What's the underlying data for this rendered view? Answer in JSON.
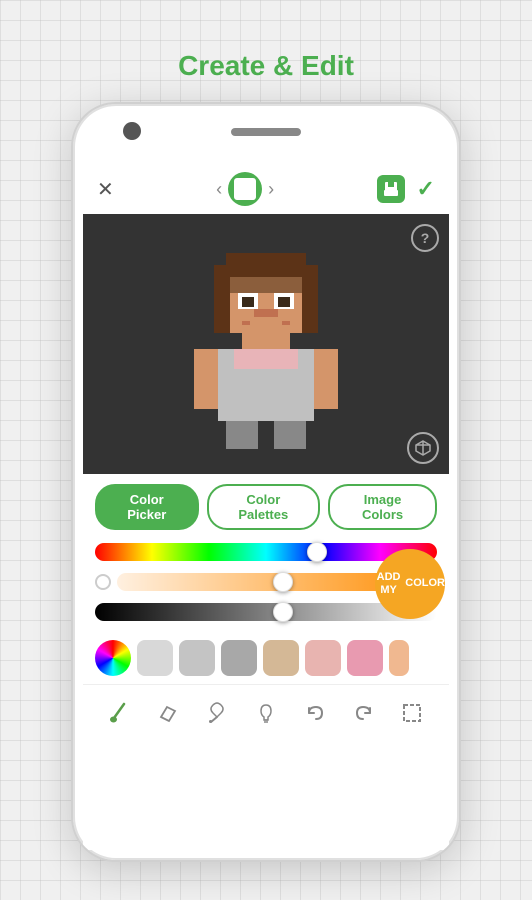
{
  "page": {
    "title": "Create & Edit",
    "background_color": "#f0f0f0"
  },
  "toolbar": {
    "close_label": "✕",
    "arrow_left_label": "‹",
    "arrow_right_label": "›",
    "check_label": "✓"
  },
  "canvas": {
    "help_label": "?",
    "cube_label": "⬡"
  },
  "tabs": [
    {
      "id": "color-picker",
      "label": "Color Picker",
      "active": true
    },
    {
      "id": "color-palettes",
      "label": "Color Palettes",
      "active": false
    },
    {
      "id": "image-colors",
      "label": "Image Colors",
      "active": false
    }
  ],
  "add_color_button": {
    "line1": "ADD MY",
    "line2": "COLOR"
  },
  "swatches": [
    {
      "color": "#d0d0d0"
    },
    {
      "color": "#c0c0c0"
    },
    {
      "color": "#a0a0a0"
    },
    {
      "color": "#d4b896"
    },
    {
      "color": "#e8b4b0"
    },
    {
      "color": "#e8a0b0"
    }
  ],
  "tools": [
    {
      "name": "paintbrush-icon",
      "symbol": "🖌"
    },
    {
      "name": "eraser-icon",
      "symbol": "⬡"
    },
    {
      "name": "eyedropper-icon",
      "symbol": "💉"
    },
    {
      "name": "lightbulb-icon",
      "symbol": "💡"
    },
    {
      "name": "undo-icon",
      "symbol": "↩"
    },
    {
      "name": "redo-icon",
      "symbol": "↪"
    },
    {
      "name": "select-icon",
      "symbol": "⬜"
    }
  ],
  "sliders": {
    "hue_position_pct": 65,
    "saturation_position_pct": 52,
    "brightness_position_pct": 55
  }
}
